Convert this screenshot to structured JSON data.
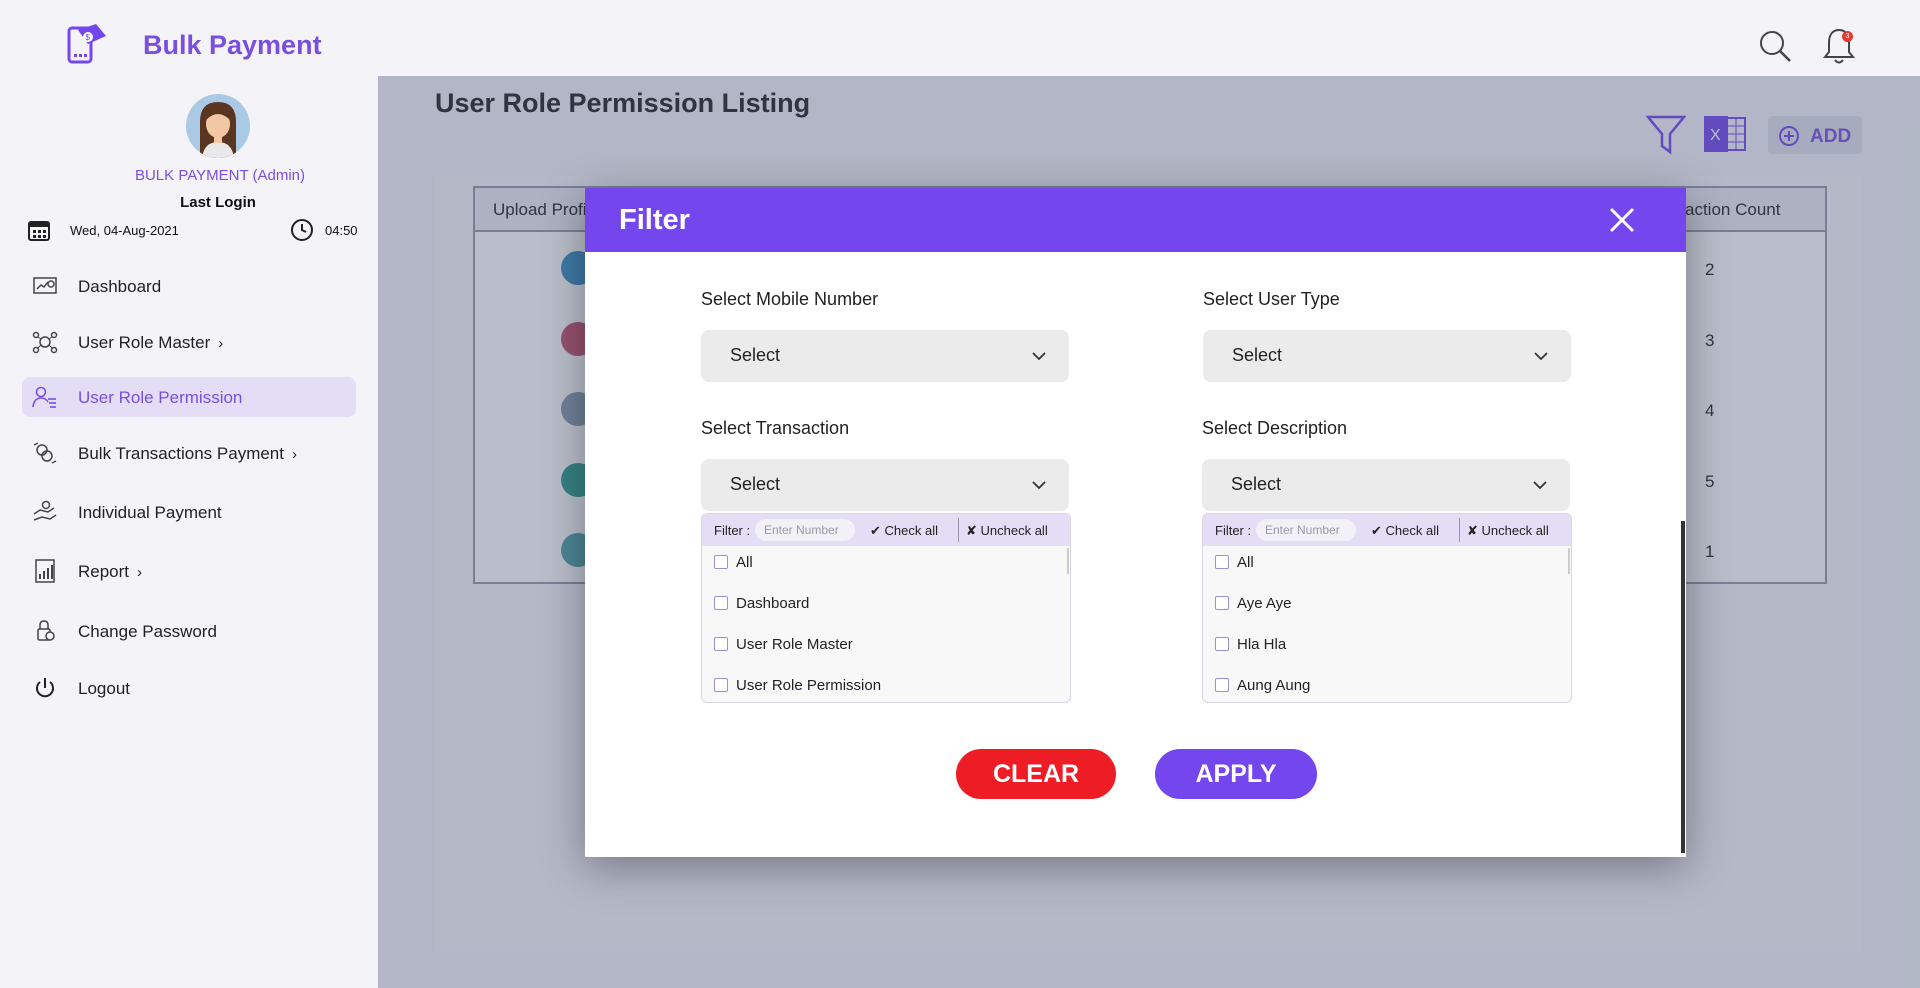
{
  "app": {
    "title": "Bulk Payment"
  },
  "header": {
    "notification_count": "3"
  },
  "user": {
    "name": "BULK PAYMENT (Admin)",
    "last_login_label": "Last Login",
    "last_login_date": "Wed, 04-Aug-2021",
    "last_login_time": "04:50"
  },
  "sidebar": {
    "items": [
      {
        "label": "Dashboard",
        "icon": "dashboard-icon",
        "has_submenu": false,
        "active": false
      },
      {
        "label": "User Role Master",
        "icon": "user-role-master-icon",
        "has_submenu": true,
        "active": false
      },
      {
        "label": "User Role Permission",
        "icon": "user-role-permission-icon",
        "has_submenu": false,
        "active": true
      },
      {
        "label": "Bulk Transactions Payment",
        "icon": "bulk-transactions-icon",
        "has_submenu": true,
        "active": false
      },
      {
        "label": "Individual Payment",
        "icon": "individual-payment-icon",
        "has_submenu": false,
        "active": false
      },
      {
        "label": "Report",
        "icon": "report-icon",
        "has_submenu": true,
        "active": false
      },
      {
        "label": "Change Password",
        "icon": "change-password-icon",
        "has_submenu": false,
        "active": false
      },
      {
        "label": "Logout",
        "icon": "logout-icon",
        "has_submenu": false,
        "active": false
      }
    ]
  },
  "main": {
    "page_title": "User Role Permission Listing",
    "add_label": "ADD",
    "table": {
      "col_upload": "Upload Profi",
      "col_count": "action Count",
      "rows": [
        {
          "count": "2",
          "avatar_color": "#3b8fc4"
        },
        {
          "count": "3",
          "avatar_color": "#c7506b"
        },
        {
          "count": "4",
          "avatar_color": "#8a9bb0"
        },
        {
          "count": "5",
          "avatar_color": "#2d9c8f"
        },
        {
          "count": "1",
          "avatar_color": "#4fa3a8"
        }
      ]
    }
  },
  "modal": {
    "title": "Filter",
    "mobile": {
      "label": "Select Mobile Number",
      "value": "Select"
    },
    "user_type": {
      "label": "Select User Type",
      "value": "Select"
    },
    "transaction": {
      "label": "Select Transaction",
      "value": "Select",
      "filter_label": "Filter :",
      "filter_placeholder": "Enter Number",
      "check_all": "Check all",
      "uncheck_all": "Uncheck all",
      "options": [
        "All",
        "Dashboard",
        "User Role Master",
        "User Role Permission"
      ]
    },
    "description": {
      "label": "Select Description",
      "value": "Select",
      "filter_label": "Filter :",
      "filter_placeholder": "Enter Number",
      "check_all": "Check all",
      "uncheck_all": "Uncheck all",
      "options": [
        "All",
        "Aye Aye",
        "Hla Hla",
        "Aung Aung"
      ]
    },
    "clear_label": "CLEAR",
    "apply_label": "APPLY"
  },
  "colors": {
    "accent": "#7346ee",
    "brand_text": "#7a4fe0",
    "clear": "#ee1d25",
    "active_nav_bg": "#e3def6"
  }
}
